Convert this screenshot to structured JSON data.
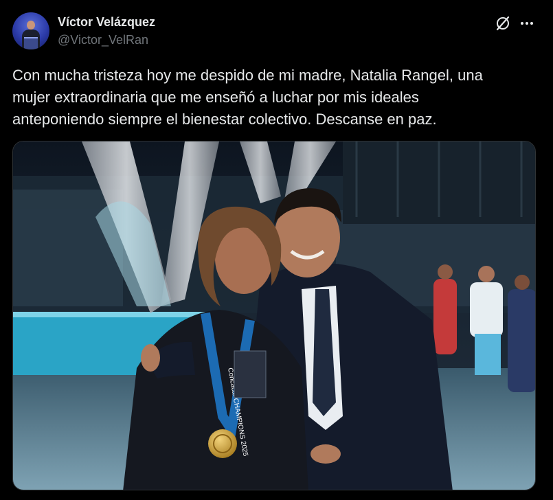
{
  "author": {
    "display_name": "Víctor Velázquez",
    "handle": "@Victor_VelRan"
  },
  "icons": {
    "avatar": "profile-avatar",
    "grok": "grok-slash-circle-icon",
    "more": "more-horizontal-icon"
  },
  "tweet": {
    "text": "Con mucha tristeza hoy me despido de mi madre, Natalia Rangel, una\nmujer extraordinaria que me enseñó a luchar por mis ideales\nanteponiendo siempre el bienestar colectivo. Descanse en paz."
  },
  "media": {
    "lanyard_text": "Concacaf CHAMPIONS 2025",
    "colors": {
      "stadium_dark": "#101822",
      "pitch_blue": "#2a9fc0",
      "trophy_silver": "#c8ccd2",
      "suit_navy": "#141b2b",
      "medal_gold": "#d4a93a"
    }
  },
  "theme": {
    "background": "#000000",
    "text_primary": "#e7e9ea",
    "text_secondary": "#71767b",
    "border": "#2f3336"
  }
}
